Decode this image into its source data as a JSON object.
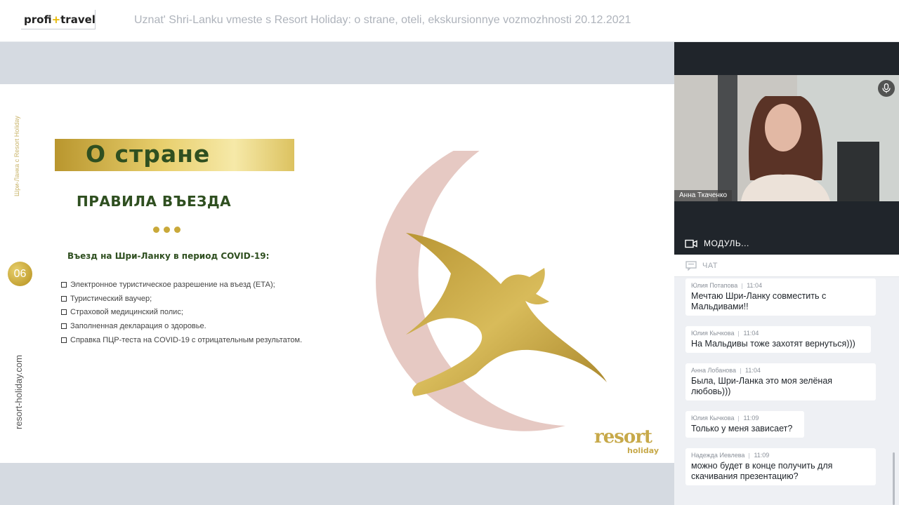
{
  "header": {
    "logo_left": "profi",
    "logo_plus": "+",
    "logo_right": "travel",
    "title": "Uznat' Shri-Lanku vmeste s Resort Holiday: o strane, oteli, ekskursionnye vozmozhnosti 20.12.2021"
  },
  "slide": {
    "side_text_top": "Шри-Ланка с Resort Holiday",
    "side_text_bottom": "resort-holiday.com",
    "page_number": "06",
    "banner": "О стране",
    "heading": "ПРАВИЛА ВЪЕЗДА",
    "intro": "Въезд на Шри-Ланку в период COVID-19:",
    "bullets": [
      "Электронное туристическое разрешение на въезд (ЕТА);",
      "Туристический ваучер;",
      "Страховой медицинский полис;",
      "Заполненная декларация о здоровье.",
      "Справка ПЦР-теста на COVID-19 с отрицательным результатом."
    ],
    "brand_main": "resort",
    "brand_sub": "holiday",
    "colors": {
      "gold": "#c9a93a",
      "green": "#2f4f20",
      "crescent": "#e6c9c3"
    }
  },
  "video": {
    "speaker_name": "Анна Ткаченко",
    "mic_icon": "microphone-icon",
    "modules_label": "МОДУЛЬ..."
  },
  "chat": {
    "header_label": "ЧАТ",
    "messages": [
      {
        "author": "Юлия Потапова",
        "time": "11:04",
        "text": "Мечтаю Шри-Ланку совместить с Мальдивами!!"
      },
      {
        "author": "Юлия Кычкова",
        "time": "11:04",
        "text": "На Мальдивы тоже захотят вернуться)))"
      },
      {
        "author": "Анна Лобанова",
        "time": "11:04",
        "text": "Была, Шри-Ланка это моя зелёная любовь)))"
      },
      {
        "author": "Юлия Кычкова",
        "time": "11:09",
        "text": "Только у меня зависает?"
      },
      {
        "author": "Надежда Иевлева",
        "time": "11:09",
        "text": "можно будет в конце получить для скачивания презентацию?"
      }
    ]
  }
}
